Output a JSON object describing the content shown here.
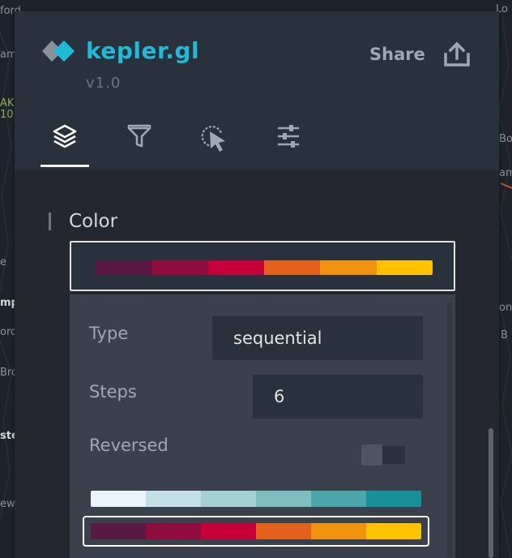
{
  "map": {
    "labels": [
      {
        "text": "ford",
        "style": ""
      },
      {
        "text": "am",
        "style": ""
      },
      {
        "text": "AK",
        "style": "green"
      },
      {
        "text": "10",
        "style": "green"
      },
      {
        "text": "e",
        "style": ""
      },
      {
        "text": "mp",
        "style": "bright"
      },
      {
        "text": "oro",
        "style": ""
      },
      {
        "text": "Bro",
        "style": ""
      },
      {
        "text": "ste",
        "style": "bright"
      },
      {
        "text": "ew",
        "style": ""
      },
      {
        "text": "Lo",
        "style": ""
      },
      {
        "text": "Bo",
        "style": ""
      },
      {
        "text": "am",
        "style": ""
      },
      {
        "text": "on",
        "style": ""
      },
      {
        "text": "B",
        "style": ""
      }
    ]
  },
  "header": {
    "app_name": "kepler.gl",
    "version": "v1.0",
    "share_label": "Share",
    "share_icon": "upload-icon",
    "logo_colors": [
      "#1fbad6",
      "#8b9099"
    ]
  },
  "tabs": [
    {
      "name": "layers",
      "icon": "layers-icon",
      "active": true
    },
    {
      "name": "filters",
      "icon": "filter-icon",
      "active": false
    },
    {
      "name": "interactions",
      "icon": "cursor-click-icon",
      "active": false
    },
    {
      "name": "map-settings",
      "icon": "settings-sliders-icon",
      "active": false
    }
  ],
  "color_section": {
    "title": "Color",
    "selected_palette": [
      "#5a1846",
      "#900c3f",
      "#c70039",
      "#e3611c",
      "#f1920e",
      "#ffc300"
    ],
    "config": {
      "type_label": "Type",
      "type_value": "sequential",
      "steps_label": "Steps",
      "steps_value": "6",
      "reversed_label": "Reversed",
      "reversed_on": false
    },
    "palette_options": [
      {
        "colors": [
          "#ebf6fc",
          "#c2e0e3",
          "#a6d1d3",
          "#7fbdc0",
          "#4ca7ac",
          "#179099"
        ],
        "selected": false
      },
      {
        "colors": [
          "#5a1846",
          "#900c3f",
          "#c70039",
          "#e3611c",
          "#f1920e",
          "#ffc300"
        ],
        "selected": true
      }
    ]
  },
  "colors": {
    "accent": "#1fbad6",
    "panel_bg": "#29323c",
    "body_bg": "#242730"
  }
}
